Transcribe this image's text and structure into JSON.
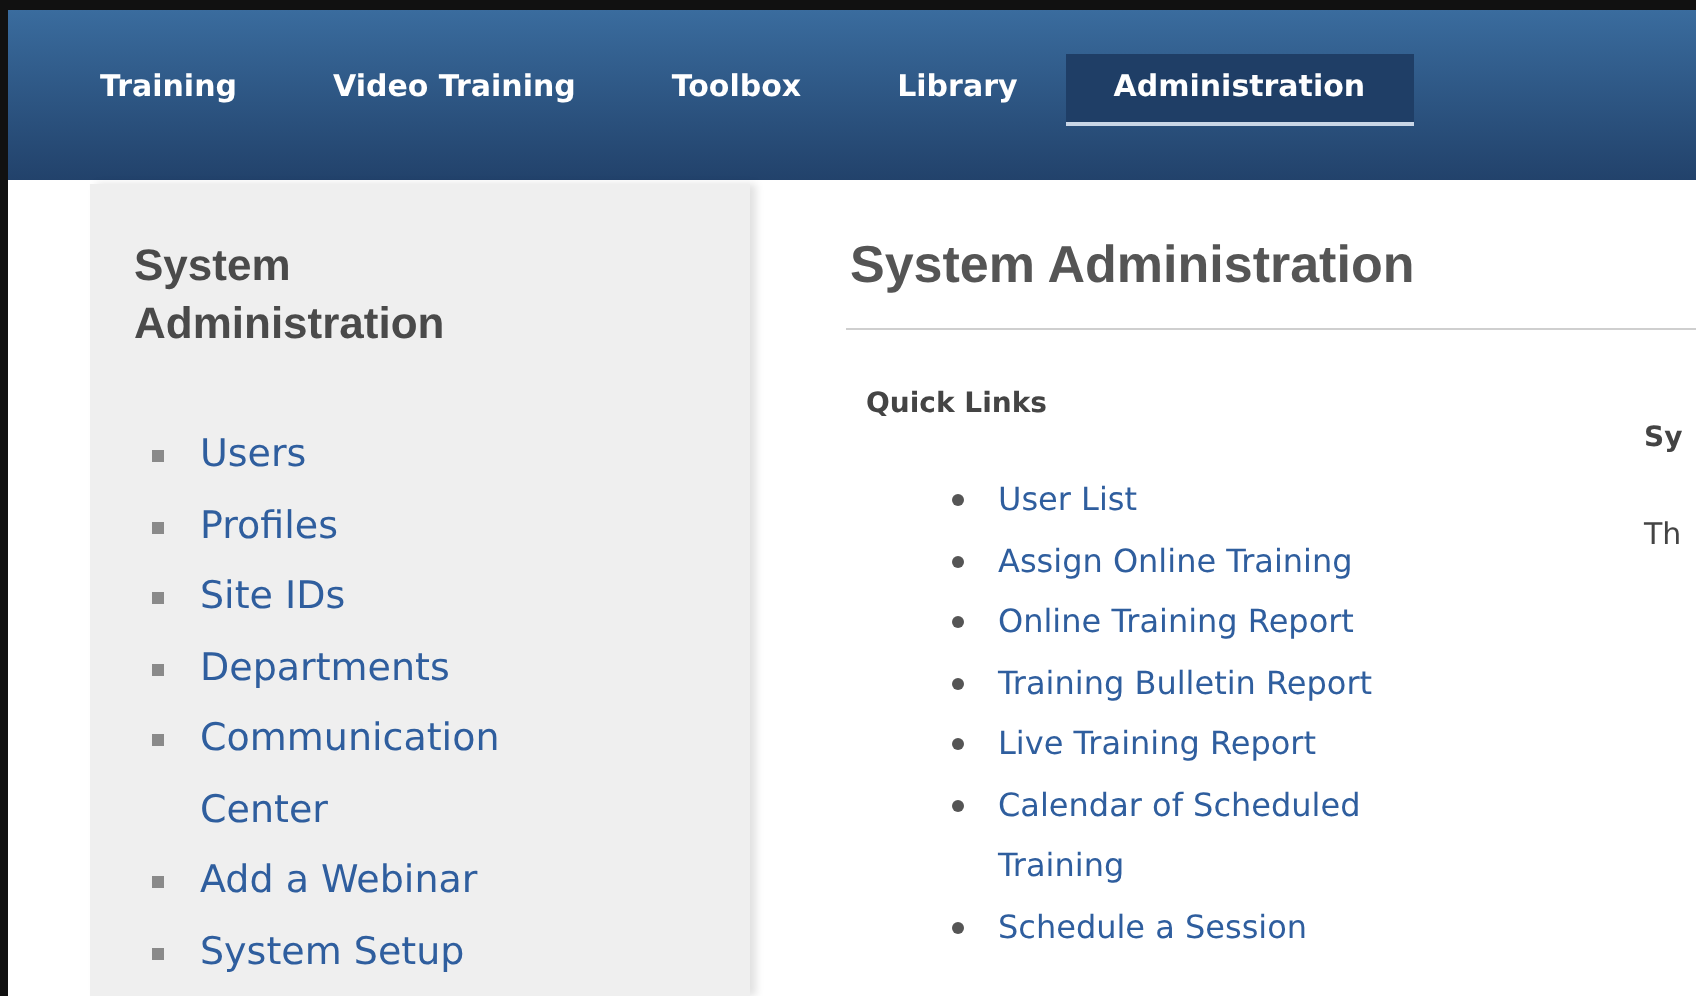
{
  "nav": {
    "tabs": [
      {
        "label": "Training",
        "selected": false
      },
      {
        "label": "Video Training",
        "selected": false
      },
      {
        "label": "Toolbox",
        "selected": false
      },
      {
        "label": "Library",
        "selected": false
      },
      {
        "label": "Administration",
        "selected": true
      }
    ]
  },
  "sidebar": {
    "title": "System Administration",
    "items": [
      "Users",
      "Profiles",
      "Site IDs",
      "Departments",
      "Communication Center",
      "Add a Webinar",
      "System Setup"
    ]
  },
  "main": {
    "title": "System Administration",
    "quick_links": {
      "title": "Quick Links",
      "items": [
        "User List",
        "Assign Online Training",
        "Online Training Report",
        "Training Bulletin Report",
        "Live Training Report",
        "Calendar of Scheduled Training",
        "Schedule a Session"
      ]
    },
    "column_2": {
      "heading": "Sy",
      "text": "Th"
    }
  }
}
